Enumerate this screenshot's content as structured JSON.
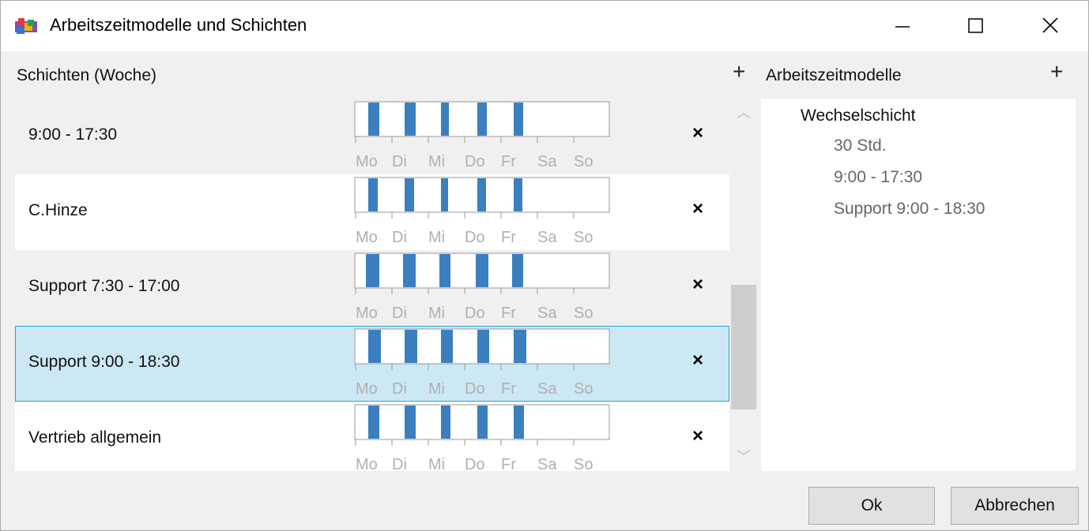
{
  "window": {
    "title": "Arbeitszeitmodelle und Schichten"
  },
  "shifts_panel": {
    "header": "Schichten (Woche)",
    "add_label": "+",
    "days": [
      "Mo",
      "Di",
      "Mi",
      "Do",
      "Fr",
      "Sa",
      "So"
    ],
    "rows": [
      {
        "label": "9:00 - 17:30",
        "delete": "×"
      },
      {
        "label": "C.Hinze",
        "delete": "×"
      },
      {
        "label": "Support 7:30 - 17:00",
        "delete": "×"
      },
      {
        "label": "Support 9:00 - 18:30",
        "delete": "×",
        "selected": true
      },
      {
        "label": "Vertrieb allgemein",
        "delete": "×"
      }
    ]
  },
  "models_panel": {
    "header": "Arbeitszeitmodelle",
    "add_label": "+",
    "tree": {
      "root": "Wechselschicht",
      "children": [
        "30 Std.",
        "9:00 - 17:30",
        "Support 9:00 - 18:30"
      ]
    }
  },
  "buttons": {
    "ok": "Ok",
    "cancel": "Abbrechen"
  },
  "colors": {
    "shift_bar": "#3c7fbf",
    "selection": "#cce8f4",
    "selection_border": "#26a0da"
  }
}
